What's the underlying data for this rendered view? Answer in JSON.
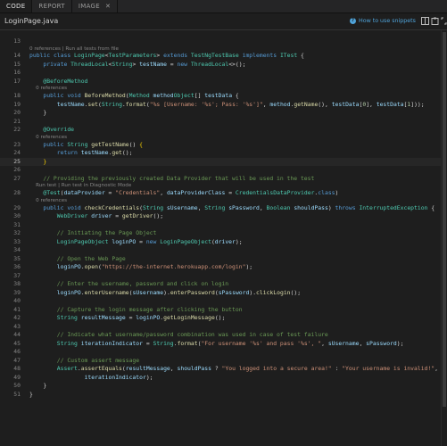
{
  "tabs": [
    {
      "label": "CODE",
      "active": true
    },
    {
      "label": "REPORT",
      "active": false
    },
    {
      "label": "IMAGE",
      "active": false,
      "closable": true,
      "close": "✕"
    }
  ],
  "file": {
    "name": "LoginPage.java",
    "snippets_link": "How to use snippets",
    "icons": [
      "split-icon",
      "clipboard-icon",
      "expand-icon"
    ]
  },
  "colors": {
    "keyword": "#569cd6",
    "type": "#4ec9b0",
    "function": "#dcdcaa",
    "variable": "#9cdcfe",
    "string": "#ce9178",
    "comment": "#6a9955",
    "link": "#4fa3d9"
  },
  "code": [
    {
      "n": "13",
      "segs": [
        [
          "",
          ""
        ]
      ]
    },
    {
      "lens": "0 references | Run all tests from file"
    },
    {
      "n": "14",
      "segs": [
        [
          "kw",
          "public "
        ],
        [
          "kw",
          "class "
        ],
        [
          "ty",
          "LoginPage"
        ],
        [
          "",
          "<"
        ],
        [
          "ty",
          "TestParameters"
        ],
        [
          "",
          "> "
        ],
        [
          "kw",
          "extends "
        ],
        [
          "ty",
          "TestNgTestBase "
        ],
        [
          "kw",
          "implements "
        ],
        [
          "ty",
          "ITest"
        ],
        [
          "",
          " {"
        ]
      ]
    },
    {
      "n": "15",
      "segs": [
        [
          "",
          "    "
        ],
        [
          "kw",
          "private "
        ],
        [
          "ty",
          "ThreadLocal"
        ],
        [
          "",
          "<"
        ],
        [
          "ty",
          "String"
        ],
        [
          "",
          "> "
        ],
        [
          "var",
          "testName"
        ],
        [
          "",
          " = "
        ],
        [
          "kw",
          "new "
        ],
        [
          "ty",
          "ThreadLocal"
        ],
        [
          "",
          "<>();"
        ]
      ]
    },
    {
      "n": "16",
      "segs": [
        [
          "",
          ""
        ]
      ]
    },
    {
      "n": "17",
      "segs": [
        [
          "",
          "    "
        ],
        [
          "an",
          "@BeforeMethod"
        ]
      ]
    },
    {
      "lens": "    0 references"
    },
    {
      "n": "18",
      "segs": [
        [
          "",
          "    "
        ],
        [
          "kw",
          "public void "
        ],
        [
          "fn",
          "BeforeMethod"
        ],
        [
          "",
          "("
        ],
        [
          "ty",
          "Method "
        ],
        [
          "var",
          "method"
        ],
        [
          ", "
        ],
        [
          "ty",
          "Object"
        ],
        [
          "",
          "[] "
        ],
        [
          "var",
          "testData"
        ],
        [
          "",
          " {"
        ]
      ]
    },
    {
      "n": "19",
      "segs": [
        [
          "",
          "        "
        ],
        [
          "var",
          "testName"
        ],
        [
          "",
          "."
        ],
        [
          "fn",
          "set"
        ],
        [
          "",
          "("
        ],
        [
          "ty",
          "String"
        ],
        [
          "",
          "."
        ],
        [
          "fn",
          "format"
        ],
        [
          "",
          "("
        ],
        [
          "str",
          "\"%s [Username: '%s'; Pass: '%s']\""
        ],
        [
          "",
          ", "
        ],
        [
          "var",
          "method"
        ],
        [
          "",
          "."
        ],
        [
          "fn",
          "getName"
        ],
        [
          "",
          "(), "
        ],
        [
          "var",
          "testData"
        ],
        [
          "",
          "["
        ],
        [
          "num",
          "0"
        ],
        [
          "",
          "], "
        ],
        [
          "var",
          "testData"
        ],
        [
          "",
          "["
        ],
        [
          "num",
          "1"
        ],
        [
          "",
          "]));"
        ]
      ]
    },
    {
      "n": "20",
      "segs": [
        [
          "",
          "    }"
        ]
      ]
    },
    {
      "n": "21",
      "segs": [
        [
          "",
          ""
        ]
      ]
    },
    {
      "n": "22",
      "segs": [
        [
          "",
          "    "
        ],
        [
          "an",
          "@Override"
        ]
      ]
    },
    {
      "lens": "    0 references"
    },
    {
      "n": "23",
      "segs": [
        [
          "",
          "    "
        ],
        [
          "kw",
          "public "
        ],
        [
          "ty",
          "String "
        ],
        [
          "fn",
          "getTestName"
        ],
        [
          "",
          "() "
        ],
        [
          "br",
          "{"
        ]
      ]
    },
    {
      "n": "24",
      "segs": [
        [
          "",
          "        "
        ],
        [
          "kw",
          "return "
        ],
        [
          "var",
          "testName"
        ],
        [
          "",
          "."
        ],
        [
          "fn",
          "get"
        ],
        [
          "",
          "();"
        ]
      ]
    },
    {
      "n": "25",
      "current": true,
      "segs": [
        [
          "",
          "    "
        ],
        [
          "br",
          "}"
        ]
      ]
    },
    {
      "n": "26",
      "segs": [
        [
          "",
          ""
        ]
      ]
    },
    {
      "n": "27",
      "segs": [
        [
          "",
          "    "
        ],
        [
          "cm",
          "// Providing the previously created Data Provider that will be used in the test"
        ]
      ]
    },
    {
      "lens": "    Run test | Run test in Diagnostic Mode"
    },
    {
      "n": "28",
      "segs": [
        [
          "",
          "    "
        ],
        [
          "an",
          "@Test"
        ],
        [
          "",
          "("
        ],
        [
          "var",
          "dataProvider"
        ],
        [
          "",
          " = "
        ],
        [
          "str",
          "\"Credentials\""
        ],
        [
          "",
          ", "
        ],
        [
          "var",
          "dataProviderClass"
        ],
        [
          "",
          " = "
        ],
        [
          "ty",
          "CredentialsDataProvider"
        ],
        [
          "",
          "."
        ],
        [
          "kw",
          "class"
        ],
        [
          "",
          ")"
        ]
      ]
    },
    {
      "lens": "    0 references"
    },
    {
      "n": "29",
      "segs": [
        [
          "",
          "    "
        ],
        [
          "kw",
          "public void "
        ],
        [
          "fn",
          "checkCredentials"
        ],
        [
          "",
          "("
        ],
        [
          "ty",
          "String "
        ],
        [
          "var",
          "sUsername"
        ],
        [
          "",
          ", "
        ],
        [
          "ty",
          "String "
        ],
        [
          "var",
          "sPassword"
        ],
        [
          "",
          ", "
        ],
        [
          "ty",
          "Boolean "
        ],
        [
          "var",
          "shouldPass"
        ],
        [
          "",
          ") "
        ],
        [
          "kw",
          "throws "
        ],
        [
          "ty",
          "InterruptedException"
        ],
        [
          "",
          " {"
        ]
      ]
    },
    {
      "n": "30",
      "segs": [
        [
          "",
          "        "
        ],
        [
          "ty",
          "WebDriver "
        ],
        [
          "var",
          "driver"
        ],
        [
          "",
          " = "
        ],
        [
          "fn",
          "getDriver"
        ],
        [
          "",
          "();"
        ]
      ]
    },
    {
      "n": "31",
      "segs": [
        [
          "",
          ""
        ]
      ]
    },
    {
      "n": "32",
      "segs": [
        [
          "",
          "        "
        ],
        [
          "cm",
          "// Initiating the Page Object"
        ]
      ]
    },
    {
      "n": "33",
      "segs": [
        [
          "",
          "        "
        ],
        [
          "ty",
          "LoginPageObject "
        ],
        [
          "var",
          "loginPO"
        ],
        [
          "",
          " = "
        ],
        [
          "kw",
          "new "
        ],
        [
          "ty",
          "LoginPageObject"
        ],
        [
          "",
          "("
        ],
        [
          "var",
          "driver"
        ],
        [
          "",
          ");"
        ]
      ]
    },
    {
      "n": "34",
      "segs": [
        [
          "",
          ""
        ]
      ]
    },
    {
      "n": "35",
      "segs": [
        [
          "",
          "        "
        ],
        [
          "cm",
          "// Open the Web Page"
        ]
      ]
    },
    {
      "n": "36",
      "segs": [
        [
          "",
          "        "
        ],
        [
          "var",
          "loginPO"
        ],
        [
          "",
          "."
        ],
        [
          "fn",
          "open"
        ],
        [
          "",
          "("
        ],
        [
          "str",
          "\"https://the-internet.herokuapp.com/login\""
        ],
        [
          "",
          ");"
        ]
      ]
    },
    {
      "n": "37",
      "segs": [
        [
          "",
          ""
        ]
      ]
    },
    {
      "n": "38",
      "segs": [
        [
          "",
          "        "
        ],
        [
          "cm",
          "// Enter the username, password and click on login"
        ]
      ]
    },
    {
      "n": "39",
      "segs": [
        [
          "",
          "        "
        ],
        [
          "var",
          "loginPO"
        ],
        [
          "",
          "."
        ],
        [
          "fn",
          "enterUsername"
        ],
        [
          "",
          "("
        ],
        [
          "var",
          "sUsername"
        ],
        [
          "",
          ")."
        ],
        [
          "fn",
          "enterPassword"
        ],
        [
          "",
          "("
        ],
        [
          "var",
          "sPassword"
        ],
        [
          "",
          ")."
        ],
        [
          "fn",
          "clickLogin"
        ],
        [
          "",
          "();"
        ]
      ]
    },
    {
      "n": "40",
      "segs": [
        [
          "",
          ""
        ]
      ]
    },
    {
      "n": "41",
      "segs": [
        [
          "",
          "        "
        ],
        [
          "cm",
          "// Capture the login message after clicking the button"
        ]
      ]
    },
    {
      "n": "42",
      "segs": [
        [
          "",
          "        "
        ],
        [
          "ty",
          "String "
        ],
        [
          "var",
          "resultMessage"
        ],
        [
          "",
          " = "
        ],
        [
          "var",
          "loginPO"
        ],
        [
          "",
          "."
        ],
        [
          "fn",
          "getLoginMessage"
        ],
        [
          "",
          "();"
        ]
      ]
    },
    {
      "n": "43",
      "segs": [
        [
          "",
          ""
        ]
      ]
    },
    {
      "n": "44",
      "segs": [
        [
          "",
          "        "
        ],
        [
          "cm",
          "// Indicate what username/password combination was used in case of test failure"
        ]
      ]
    },
    {
      "n": "45",
      "segs": [
        [
          "",
          "        "
        ],
        [
          "ty",
          "String "
        ],
        [
          "var",
          "iterationIndicator"
        ],
        [
          "",
          " = "
        ],
        [
          "ty",
          "String"
        ],
        [
          "",
          "."
        ],
        [
          "fn",
          "format"
        ],
        [
          "",
          "("
        ],
        [
          "str",
          "\"For username '%s' and pass '%s', \""
        ],
        [
          "",
          ", "
        ],
        [
          "var",
          "sUsername"
        ],
        [
          "",
          ", "
        ],
        [
          "var",
          "sPassword"
        ],
        [
          "",
          ");"
        ]
      ]
    },
    {
      "n": "46",
      "segs": [
        [
          "",
          ""
        ]
      ]
    },
    {
      "n": "47",
      "segs": [
        [
          "",
          "        "
        ],
        [
          "cm",
          "// Custom assert message"
        ]
      ]
    },
    {
      "n": "48",
      "segs": [
        [
          "",
          "        "
        ],
        [
          "ty",
          "Assert"
        ],
        [
          "",
          "."
        ],
        [
          "fn",
          "assertEquals"
        ],
        [
          "",
          "("
        ],
        [
          "var",
          "resultMessage"
        ],
        [
          "",
          ", "
        ],
        [
          "var",
          "shouldPass"
        ],
        [
          "",
          " ? "
        ],
        [
          "str",
          "\"You logged into a secure area!\""
        ],
        [
          "",
          " : "
        ],
        [
          "str",
          "\"Your username is invalid!\""
        ],
        [
          "",
          ","
        ]
      ]
    },
    {
      "n": "49",
      "segs": [
        [
          "",
          "                "
        ],
        [
          "var",
          "iterationIndicator"
        ],
        [
          "",
          ");"
        ]
      ]
    },
    {
      "n": "50",
      "segs": [
        [
          "",
          "    }"
        ]
      ]
    },
    {
      "n": "51",
      "segs": [
        [
          "",
          "}"
        ]
      ]
    }
  ]
}
